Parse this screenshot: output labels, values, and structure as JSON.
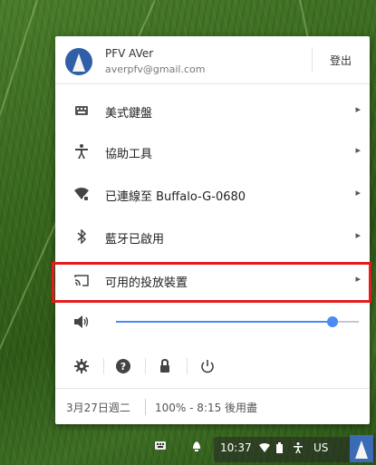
{
  "user": {
    "name": "PFV AVer",
    "email": "averpfv@gmail.com",
    "signout_label": "登出"
  },
  "menu": [
    {
      "icon": "keyboard-icon",
      "label": "美式鍵盤"
    },
    {
      "icon": "accessibility-icon",
      "label": "協助工具"
    },
    {
      "icon": "wifi-icon",
      "label": "已連線至 Buffalo-G-0680"
    },
    {
      "icon": "bluetooth-icon",
      "label": "藍牙已啟用"
    },
    {
      "icon": "cast-icon",
      "label": "可用的投放裝置"
    }
  ],
  "volume": {
    "icon": "volume-icon",
    "level": 0.89
  },
  "tools": [
    "settings-icon",
    "help-icon",
    "lock-icon",
    "power-icon"
  ],
  "status": {
    "date": "3月27日週二",
    "battery": "100% - 8:15 後用盡"
  },
  "shelf": {
    "time": "10:37",
    "ime": "US"
  },
  "colors": {
    "accent": "#4a8af4",
    "highlight": "#e31b1b"
  }
}
